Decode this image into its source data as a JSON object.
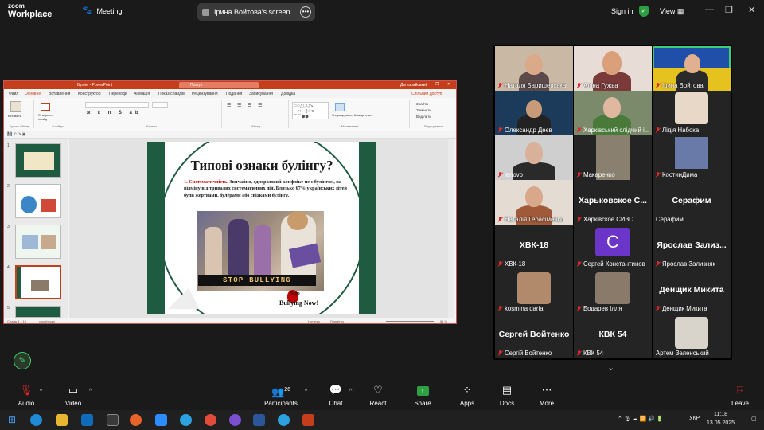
{
  "app": {
    "logo_line1": "zoom",
    "logo_line2": "Workplace",
    "meeting_label": "Meeting",
    "screen_share_label": "Ірина Войтова's screen",
    "sign_in": "Sign in",
    "view": "View"
  },
  "ppt": {
    "window_title": "Булінг - PowerPoint",
    "search_placeholder": "Пошук",
    "user": "Дегтарайський",
    "tabs": [
      "Файл",
      "Основне",
      "Вставлення",
      "Конструктор",
      "Переходи",
      "Анімація",
      "Показ слайдів",
      "Рецензування",
      "Подання",
      "Записування",
      "Довідка"
    ],
    "share": "Спільний доступ",
    "ribbon_groups": [
      "Буфер обміну",
      "Слайди",
      "Шрифт",
      "Абзац",
      "Малювання",
      "Редагування"
    ],
    "ribbon_items": {
      "paste": "Вставити",
      "new_slide": "Створити слайд",
      "arrange": "Упорядкувати",
      "quick_styles": "Швидкі стилі",
      "find": "Знайти",
      "replace": "Замінити",
      "select": "Виділити"
    },
    "slide_count": [
      "1",
      "2",
      "3",
      "4",
      "5"
    ],
    "slide": {
      "title": "Типові ознаки булінгу?",
      "point_num": "1.",
      "point_label": "Систематичність.",
      "point_text": "Звичайно, одноразовий конфлікт не є булінгом, на відміну від тривалих систематичних дій. Близько 67% українських дітей були жертвами, булерами або свідками булінгу.",
      "banner": "STOP BULLYING",
      "stop_small": "Stop",
      "bullying_now": "Bullying Now!"
    },
    "status": {
      "slide_pos": "Слайд 4 з 13",
      "lang": "українська",
      "notes": "Нотатки",
      "comments": "Примітки",
      "zoom": "51 %"
    }
  },
  "participants": [
    {
      "name": "Наталя Баришевська",
      "muted": true
    },
    {
      "name": "Аліна Гужва",
      "muted": true
    },
    {
      "name": "Ірина Войтова",
      "muted": true,
      "active": true
    },
    {
      "name": "Олександр Деєв",
      "muted": true
    },
    {
      "name": "Харківський слідчий і...",
      "muted": true
    },
    {
      "name": "Лідія Набока",
      "muted": true
    },
    {
      "name": "lenovo",
      "muted": true
    },
    {
      "name": "Макаренко",
      "muted": true
    },
    {
      "name": "КостинДима",
      "muted": true
    },
    {
      "name": "Наталія Герасіменко",
      "muted": true
    },
    {
      "name": "Харківское СИЗО",
      "muted": true,
      "big": "Харьковское С..."
    },
    {
      "name": "Серафим",
      "muted": false,
      "big": "Серафим"
    },
    {
      "name": "ХВК-18",
      "muted": true,
      "big": "ХВК-18"
    },
    {
      "name": "Сергей Константинов",
      "muted": true,
      "letter": "C"
    },
    {
      "name": "Ярослав Зализняк",
      "muted": true,
      "big": "Ярослав  Зализ..."
    },
    {
      "name": "kosmina daria",
      "muted": true
    },
    {
      "name": "Бодарев Ілля",
      "muted": true
    },
    {
      "name": "Денщик Микита",
      "muted": true,
      "big": "Денщик Микита"
    },
    {
      "name": "Сергій Войтенко",
      "muted": true,
      "big": "Сергей Войтенко"
    },
    {
      "name": "КВК 54",
      "muted": true,
      "big": "КВК 54"
    },
    {
      "name": "Артем Зеленський",
      "muted": false
    }
  ],
  "toolbar": {
    "audio": "Audio",
    "video": "Video",
    "participants": "Participants",
    "participants_count": "26",
    "chat": "Chat",
    "react": "React",
    "share": "Share",
    "apps": "Apps",
    "docs": "Docs",
    "more": "More",
    "leave": "Leave"
  },
  "taskbar": {
    "lang": "УКР",
    "time": "11:18",
    "date": "13.05.2025"
  },
  "colors": {
    "zoom_bg": "#1a1a1a",
    "share_green": "#2ea043",
    "ppt_red": "#c43e1c",
    "slide_green": "#1e5b40",
    "mute_red": "#e02828",
    "active_outline": "#3fcf6a"
  }
}
